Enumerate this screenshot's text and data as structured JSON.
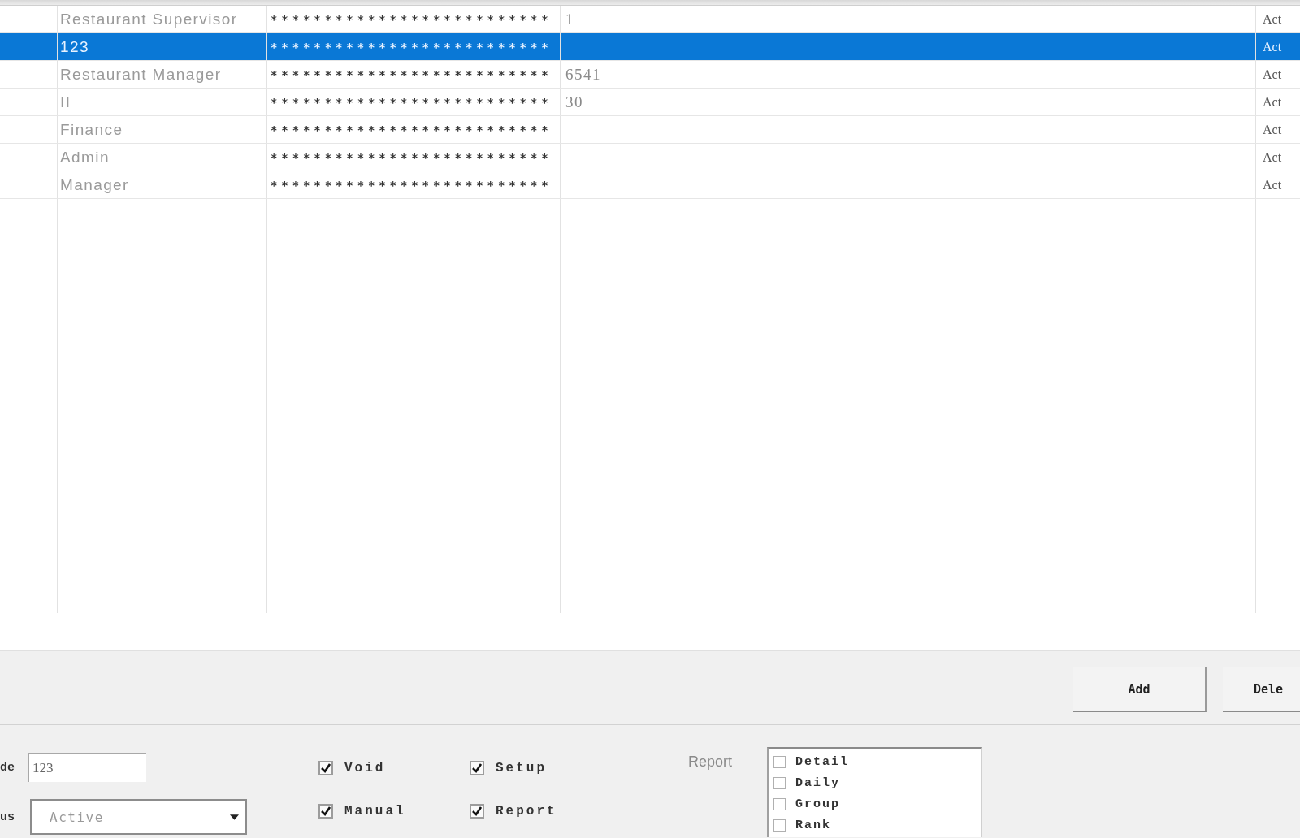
{
  "table": {
    "rows": [
      {
        "selected": false,
        "column_1": "Restaurant Supervisor",
        "column_2": "**************************",
        "column_3": "1",
        "column_4": "Act"
      },
      {
        "selected": true,
        "column_1": "123",
        "column_2": "**************************",
        "column_4": "Act"
      },
      {
        "selected": false,
        "column_1": "Restaurant Manager",
        "column_2": "**************************",
        "column_3": "6541",
        "column_4": "Act"
      },
      {
        "selected": false,
        "column_1": "II",
        "column_2": "**************************",
        "column_3": "30",
        "column_4": "Act"
      },
      {
        "selected": false,
        "column_1": "Finance",
        "column_2": "**************************",
        "column_4": "Act"
      },
      {
        "selected": false,
        "column_1": "Admin",
        "column_2": "**************************",
        "column_4": "Act"
      },
      {
        "selected": false,
        "column_1": "Manager",
        "column_2": "**************************",
        "column_4": "Act"
      }
    ]
  },
  "buttons": [
    {
      "label": "Add"
    },
    {
      "label": "Dele"
    }
  ],
  "form": {
    "code": {
      "label": "de",
      "value": "123"
    },
    "status": {
      "label": "us",
      "value": "Active"
    },
    "permissions": [
      {
        "label": "Void",
        "checked": true
      },
      {
        "label": "Setup",
        "checked": true
      },
      {
        "label": "Manual",
        "checked": true
      },
      {
        "label": "Report",
        "checked": true
      }
    ],
    "report": {
      "label": "Report",
      "items": [
        {
          "label": "Detail",
          "checked": false
        },
        {
          "label": "Daily",
          "checked": false
        },
        {
          "label": "Group",
          "checked": false
        },
        {
          "label": "Rank",
          "checked": false
        }
      ]
    }
  }
}
